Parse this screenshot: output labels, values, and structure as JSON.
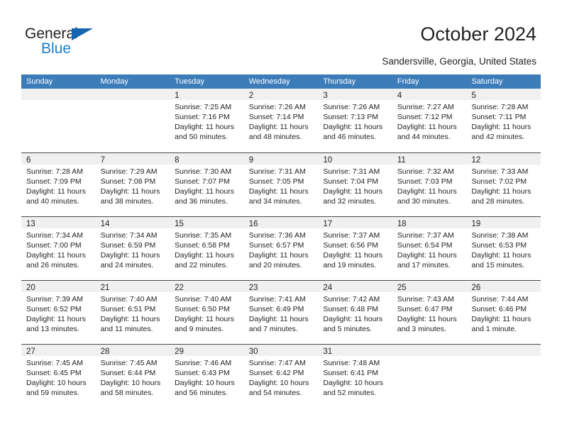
{
  "brand": {
    "name_part1": "General",
    "name_part2": "Blue",
    "triangle_icon": "blue-triangle-icon",
    "colors": {
      "dark": "#231f20",
      "blue": "#1f7ec4",
      "triangle": "#1665af"
    }
  },
  "header": {
    "title": "October 2024",
    "subtitle": "Sandersville, Georgia, United States"
  },
  "calendar": {
    "header_bg": "#3b7cb9",
    "date_band_bg": "#f0f0f0",
    "weekdays": [
      "Sunday",
      "Monday",
      "Tuesday",
      "Wednesday",
      "Thursday",
      "Friday",
      "Saturday"
    ],
    "weeks": [
      [
        {
          "empty": true
        },
        {
          "empty": true
        },
        {
          "day": "1",
          "sunrise": "Sunrise: 7:25 AM",
          "sunset": "Sunset: 7:16 PM",
          "daylight1": "Daylight: 11 hours",
          "daylight2": "and 50 minutes."
        },
        {
          "day": "2",
          "sunrise": "Sunrise: 7:26 AM",
          "sunset": "Sunset: 7:14 PM",
          "daylight1": "Daylight: 11 hours",
          "daylight2": "and 48 minutes."
        },
        {
          "day": "3",
          "sunrise": "Sunrise: 7:26 AM",
          "sunset": "Sunset: 7:13 PM",
          "daylight1": "Daylight: 11 hours",
          "daylight2": "and 46 minutes."
        },
        {
          "day": "4",
          "sunrise": "Sunrise: 7:27 AM",
          "sunset": "Sunset: 7:12 PM",
          "daylight1": "Daylight: 11 hours",
          "daylight2": "and 44 minutes."
        },
        {
          "day": "5",
          "sunrise": "Sunrise: 7:28 AM",
          "sunset": "Sunset: 7:11 PM",
          "daylight1": "Daylight: 11 hours",
          "daylight2": "and 42 minutes."
        }
      ],
      [
        {
          "day": "6",
          "sunrise": "Sunrise: 7:28 AM",
          "sunset": "Sunset: 7:09 PM",
          "daylight1": "Daylight: 11 hours",
          "daylight2": "and 40 minutes."
        },
        {
          "day": "7",
          "sunrise": "Sunrise: 7:29 AM",
          "sunset": "Sunset: 7:08 PM",
          "daylight1": "Daylight: 11 hours",
          "daylight2": "and 38 minutes."
        },
        {
          "day": "8",
          "sunrise": "Sunrise: 7:30 AM",
          "sunset": "Sunset: 7:07 PM",
          "daylight1": "Daylight: 11 hours",
          "daylight2": "and 36 minutes."
        },
        {
          "day": "9",
          "sunrise": "Sunrise: 7:31 AM",
          "sunset": "Sunset: 7:05 PM",
          "daylight1": "Daylight: 11 hours",
          "daylight2": "and 34 minutes."
        },
        {
          "day": "10",
          "sunrise": "Sunrise: 7:31 AM",
          "sunset": "Sunset: 7:04 PM",
          "daylight1": "Daylight: 11 hours",
          "daylight2": "and 32 minutes."
        },
        {
          "day": "11",
          "sunrise": "Sunrise: 7:32 AM",
          "sunset": "Sunset: 7:03 PM",
          "daylight1": "Daylight: 11 hours",
          "daylight2": "and 30 minutes."
        },
        {
          "day": "12",
          "sunrise": "Sunrise: 7:33 AM",
          "sunset": "Sunset: 7:02 PM",
          "daylight1": "Daylight: 11 hours",
          "daylight2": "and 28 minutes."
        }
      ],
      [
        {
          "day": "13",
          "sunrise": "Sunrise: 7:34 AM",
          "sunset": "Sunset: 7:00 PM",
          "daylight1": "Daylight: 11 hours",
          "daylight2": "and 26 minutes."
        },
        {
          "day": "14",
          "sunrise": "Sunrise: 7:34 AM",
          "sunset": "Sunset: 6:59 PM",
          "daylight1": "Daylight: 11 hours",
          "daylight2": "and 24 minutes."
        },
        {
          "day": "15",
          "sunrise": "Sunrise: 7:35 AM",
          "sunset": "Sunset: 6:58 PM",
          "daylight1": "Daylight: 11 hours",
          "daylight2": "and 22 minutes."
        },
        {
          "day": "16",
          "sunrise": "Sunrise: 7:36 AM",
          "sunset": "Sunset: 6:57 PM",
          "daylight1": "Daylight: 11 hours",
          "daylight2": "and 20 minutes."
        },
        {
          "day": "17",
          "sunrise": "Sunrise: 7:37 AM",
          "sunset": "Sunset: 6:56 PM",
          "daylight1": "Daylight: 11 hours",
          "daylight2": "and 19 minutes."
        },
        {
          "day": "18",
          "sunrise": "Sunrise: 7:37 AM",
          "sunset": "Sunset: 6:54 PM",
          "daylight1": "Daylight: 11 hours",
          "daylight2": "and 17 minutes."
        },
        {
          "day": "19",
          "sunrise": "Sunrise: 7:38 AM",
          "sunset": "Sunset: 6:53 PM",
          "daylight1": "Daylight: 11 hours",
          "daylight2": "and 15 minutes."
        }
      ],
      [
        {
          "day": "20",
          "sunrise": "Sunrise: 7:39 AM",
          "sunset": "Sunset: 6:52 PM",
          "daylight1": "Daylight: 11 hours",
          "daylight2": "and 13 minutes."
        },
        {
          "day": "21",
          "sunrise": "Sunrise: 7:40 AM",
          "sunset": "Sunset: 6:51 PM",
          "daylight1": "Daylight: 11 hours",
          "daylight2": "and 11 minutes."
        },
        {
          "day": "22",
          "sunrise": "Sunrise: 7:40 AM",
          "sunset": "Sunset: 6:50 PM",
          "daylight1": "Daylight: 11 hours",
          "daylight2": "and 9 minutes."
        },
        {
          "day": "23",
          "sunrise": "Sunrise: 7:41 AM",
          "sunset": "Sunset: 6:49 PM",
          "daylight1": "Daylight: 11 hours",
          "daylight2": "and 7 minutes."
        },
        {
          "day": "24",
          "sunrise": "Sunrise: 7:42 AM",
          "sunset": "Sunset: 6:48 PM",
          "daylight1": "Daylight: 11 hours",
          "daylight2": "and 5 minutes."
        },
        {
          "day": "25",
          "sunrise": "Sunrise: 7:43 AM",
          "sunset": "Sunset: 6:47 PM",
          "daylight1": "Daylight: 11 hours",
          "daylight2": "and 3 minutes."
        },
        {
          "day": "26",
          "sunrise": "Sunrise: 7:44 AM",
          "sunset": "Sunset: 6:46 PM",
          "daylight1": "Daylight: 11 hours",
          "daylight2": "and 1 minute."
        }
      ],
      [
        {
          "day": "27",
          "sunrise": "Sunrise: 7:45 AM",
          "sunset": "Sunset: 6:45 PM",
          "daylight1": "Daylight: 10 hours",
          "daylight2": "and 59 minutes."
        },
        {
          "day": "28",
          "sunrise": "Sunrise: 7:45 AM",
          "sunset": "Sunset: 6:44 PM",
          "daylight1": "Daylight: 10 hours",
          "daylight2": "and 58 minutes."
        },
        {
          "day": "29",
          "sunrise": "Sunrise: 7:46 AM",
          "sunset": "Sunset: 6:43 PM",
          "daylight1": "Daylight: 10 hours",
          "daylight2": "and 56 minutes."
        },
        {
          "day": "30",
          "sunrise": "Sunrise: 7:47 AM",
          "sunset": "Sunset: 6:42 PM",
          "daylight1": "Daylight: 10 hours",
          "daylight2": "and 54 minutes."
        },
        {
          "day": "31",
          "sunrise": "Sunrise: 7:48 AM",
          "sunset": "Sunset: 6:41 PM",
          "daylight1": "Daylight: 10 hours",
          "daylight2": "and 52 minutes."
        },
        {
          "empty": true
        },
        {
          "empty": true
        }
      ]
    ]
  }
}
